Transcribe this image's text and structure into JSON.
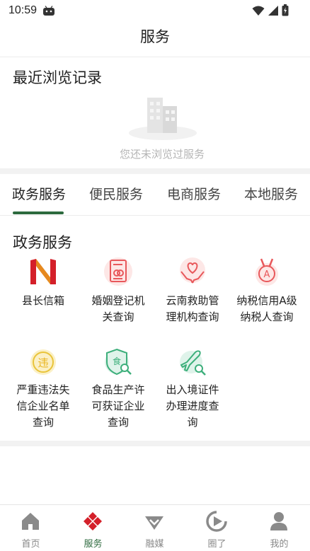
{
  "status_bar": {
    "time": "10:59"
  },
  "header": {
    "title": "服务"
  },
  "recent": {
    "title": "最近浏览记录",
    "empty_text": "您还未浏览过服务"
  },
  "tabs": [
    {
      "label": "政务服务",
      "active": true
    },
    {
      "label": "便民服务",
      "active": false
    },
    {
      "label": "电商服务",
      "active": false
    },
    {
      "label": "本地服务",
      "active": false
    }
  ],
  "section": {
    "title": "政务服务",
    "items": [
      {
        "label_lines": [
          "县长信箱"
        ],
        "icon": "mailbox-logo-icon"
      },
      {
        "label_lines": [
          "婚姻登记机",
          "关查询"
        ],
        "icon": "marriage-certificate-icon"
      },
      {
        "label_lines": [
          "云南救助管",
          "理机构查询"
        ],
        "icon": "helping-hands-icon"
      },
      {
        "label_lines": [
          "纳税信用A级",
          "纳税人查询"
        ],
        "icon": "medal-a-icon"
      },
      {
        "label_lines": [
          "严重违法失",
          "信企业名单",
          "查询"
        ],
        "icon": "violation-badge-icon"
      },
      {
        "label_lines": [
          "食品生产许",
          "可获证企业",
          "查询"
        ],
        "icon": "food-shield-search-icon"
      },
      {
        "label_lines": [
          "出入境证件",
          "办理进度查",
          "询"
        ],
        "icon": "plane-search-icon"
      }
    ]
  },
  "tabbar": [
    {
      "label": "首页",
      "icon": "home-icon",
      "active": false
    },
    {
      "label": "服务",
      "icon": "service-diamond-icon",
      "active": true
    },
    {
      "label": "融媒",
      "icon": "media-gem-icon",
      "active": false
    },
    {
      "label": "圈了",
      "icon": "play-circle-icon",
      "active": false
    },
    {
      "label": "我的",
      "icon": "person-icon",
      "active": false
    }
  ],
  "colors": {
    "accent": "#2d6a3e",
    "service_red": "#d4202a",
    "icon_red": "#e8585b",
    "icon_yellow": "#e9c43a",
    "icon_green": "#3daf7b",
    "inactive_icon": "#8a8a8a"
  }
}
